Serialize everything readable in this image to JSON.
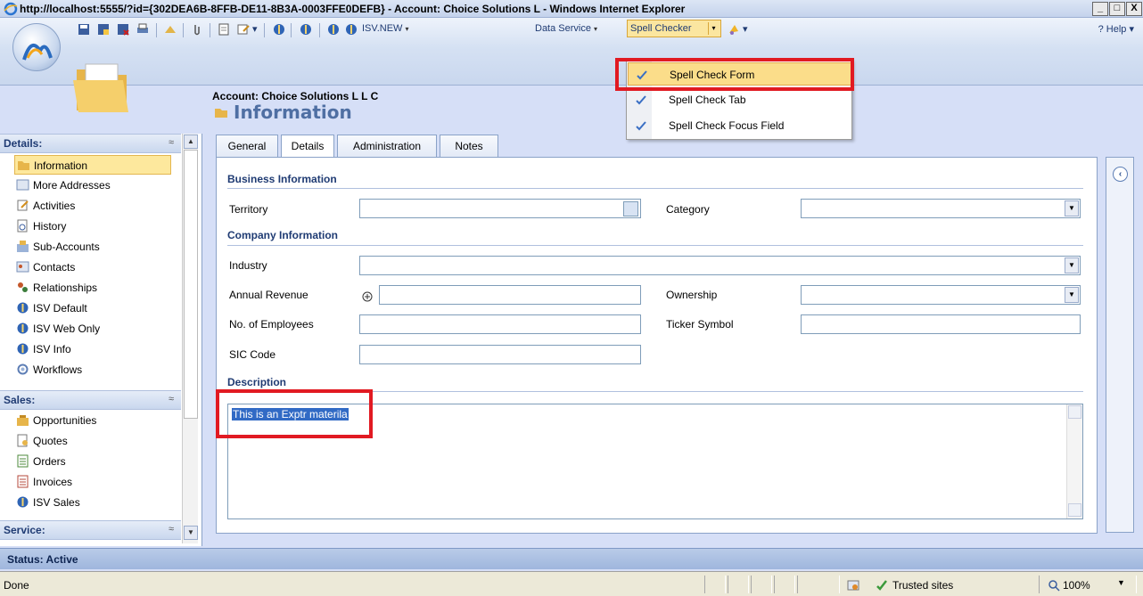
{
  "window": {
    "title": "http://localhost:5555/?id={302DEA6B-8FFB-DE11-8B3A-0003FFE0DEFB} - Account: Choice Solutions L  - Windows Internet Explorer",
    "minimize": "_",
    "maximize": "□",
    "close": "X"
  },
  "toolbar": {
    "isv_new": "ISV.NEW",
    "data_service": "Data Service",
    "spell_checker": "Spell Checker",
    "help": "Help"
  },
  "spell_menu": {
    "items": [
      {
        "label": "Spell Check Form"
      },
      {
        "label": "Spell Check Tab"
      },
      {
        "label": "Spell Check Focus Field"
      }
    ]
  },
  "record": {
    "label": "Account: Choice Solutions L L C",
    "title": "Information"
  },
  "nav": {
    "sections": [
      {
        "title": "Details:"
      },
      {
        "title": "Sales:"
      },
      {
        "title": "Service:"
      }
    ],
    "details_items": [
      {
        "label": "Information",
        "icon": "information-icon"
      },
      {
        "label": "More Addresses",
        "icon": "addresses-icon"
      },
      {
        "label": "Activities",
        "icon": "activities-icon"
      },
      {
        "label": "History",
        "icon": "history-icon"
      },
      {
        "label": "Sub-Accounts",
        "icon": "sub-accounts-icon"
      },
      {
        "label": "Contacts",
        "icon": "contacts-icon"
      },
      {
        "label": "Relationships",
        "icon": "relationships-icon"
      },
      {
        "label": "ISV Default",
        "icon": "isv-icon"
      },
      {
        "label": "ISV Web Only",
        "icon": "isv-icon"
      },
      {
        "label": "ISV Info",
        "icon": "isv-icon"
      },
      {
        "label": "Workflows",
        "icon": "workflows-icon"
      }
    ],
    "sales_items": [
      {
        "label": "Opportunities",
        "icon": "opportunities-icon"
      },
      {
        "label": "Quotes",
        "icon": "quotes-icon"
      },
      {
        "label": "Orders",
        "icon": "orders-icon"
      },
      {
        "label": "Invoices",
        "icon": "invoices-icon"
      },
      {
        "label": "ISV Sales",
        "icon": "isv-icon"
      }
    ]
  },
  "tabs": [
    {
      "label": "General"
    },
    {
      "label": "Details"
    },
    {
      "label": "Administration"
    },
    {
      "label": "Notes"
    }
  ],
  "form": {
    "business_header": "Business Information",
    "territory_label": "Territory",
    "territory_value": "",
    "category_label": "Category",
    "category_value": "",
    "company_header": "Company Information",
    "industry_label": "Industry",
    "industry_value": "",
    "annual_revenue_label": "Annual Revenue",
    "annual_revenue_value": "",
    "ownership_label": "Ownership",
    "ownership_value": "",
    "employees_label": "No. of Employees",
    "employees_value": "",
    "ticker_label": "Ticker Symbol",
    "ticker_value": "",
    "sic_label": "SIC Code",
    "sic_value": "",
    "description_header": "Description",
    "description_value": "This is an Exptr materila"
  },
  "status": {
    "text": "Status: Active"
  },
  "ie_status": {
    "done": "Done",
    "zone": "Trusted sites",
    "zoom": "100%"
  },
  "colors": {
    "highlight_box": "#e11a22",
    "accent": "#1f3b73"
  }
}
